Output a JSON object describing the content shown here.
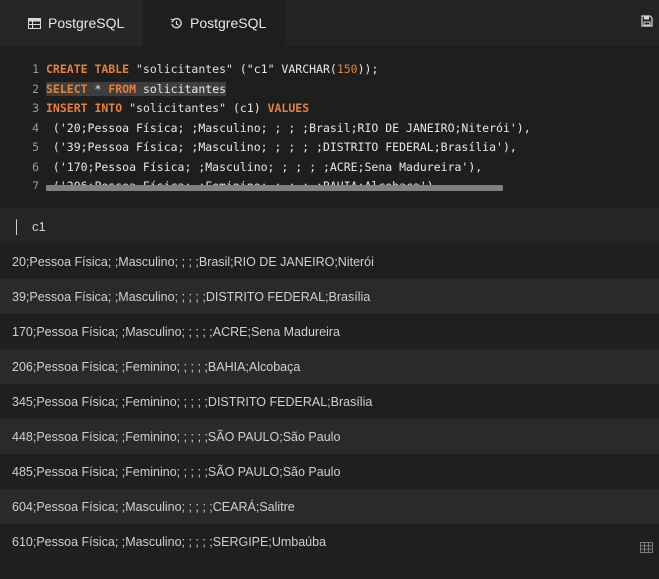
{
  "tabs": [
    {
      "label": "PostgreSQL",
      "icon": "table-icon"
    },
    {
      "label": "PostgreSQL",
      "icon": "history-icon"
    }
  ],
  "toolbar": {
    "save_icon": "save-icon"
  },
  "editor": {
    "lines": [
      {
        "n": "1",
        "tokens": [
          [
            "kw",
            "CREATE TABLE "
          ],
          [
            "str",
            "\"solicitantes\""
          ],
          [
            "plain",
            " (\"c1\" VARCHAR("
          ],
          [
            "num",
            "150"
          ],
          [
            "plain",
            "));"
          ]
        ]
      },
      {
        "n": "2",
        "selected": true,
        "tokens": [
          [
            "kw",
            "SELECT "
          ],
          [
            "plain",
            "* "
          ],
          [
            "kw",
            "FROM "
          ],
          [
            "plain",
            "solicitantes"
          ]
        ]
      },
      {
        "n": "3",
        "tokens": [
          [
            "kw",
            "INSERT INTO "
          ],
          [
            "str",
            "\"solicitantes\""
          ],
          [
            "plain",
            " (c1) "
          ],
          [
            "kw",
            "VALUES"
          ]
        ]
      },
      {
        "n": "4",
        "tokens": [
          [
            "plain",
            " ('20;Pessoa Física; ;Masculino; ; ; ;Brasil;RIO DE JANEIRO;Niterói'),"
          ]
        ]
      },
      {
        "n": "5",
        "tokens": [
          [
            "plain",
            " ('39;Pessoa Física; ;Masculino; ; ; ; ;DISTRITO FEDERAL;Brasília'),"
          ]
        ]
      },
      {
        "n": "6",
        "tokens": [
          [
            "plain",
            " ('170;Pessoa Física; ;Masculino; ; ; ; ;ACRE;Sena Madureira'),"
          ]
        ]
      },
      {
        "n": "7",
        "tokens": [
          [
            "plain",
            " ('206;Pessoa Física; ;Feminino; ; ; ; ;BAHIA;Alcobaça'),"
          ]
        ]
      }
    ]
  },
  "results": {
    "column": "c1",
    "rows": [
      "20;Pessoa Física; ;Masculino; ; ; ;Brasil;RIO DE JANEIRO;Niterói",
      "39;Pessoa Física; ;Masculino; ; ; ; ;DISTRITO FEDERAL;Brasília",
      "170;Pessoa Física; ;Masculino; ; ; ; ;ACRE;Sena Madureira",
      "206;Pessoa Física; ;Feminino; ; ; ; ;BAHIA;Alcobaça",
      "345;Pessoa Física; ;Feminino; ; ; ; ;DISTRITO FEDERAL;Brasília",
      "448;Pessoa Física; ;Feminino; ; ; ; ;SÃO PAULO;São Paulo",
      "485;Pessoa Física; ;Feminino; ; ; ; ;SÃO PAULO;São Paulo",
      "604;Pessoa Física; ;Masculino; ; ; ; ;CEARÁ;Salitre",
      "610;Pessoa Física; ;Masculino; ; ; ; ;SERGIPE;Umbaúba"
    ],
    "grid_icon": "grid-icon"
  }
}
